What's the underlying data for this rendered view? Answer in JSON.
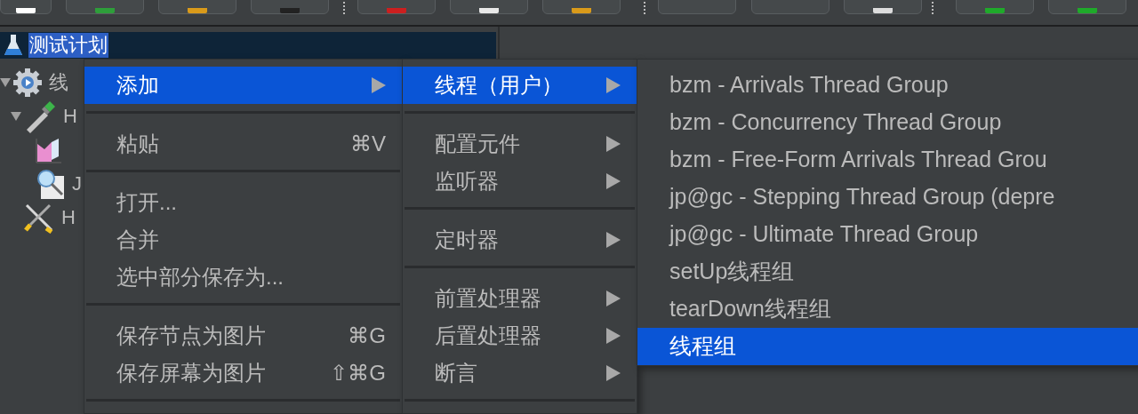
{
  "tree": {
    "items": [
      {
        "label": "测试计划",
        "kind": "test-plan",
        "selected": true,
        "children": [
          {
            "label": "线",
            "kind": "thread-group",
            "selected": false,
            "expanded": true,
            "children": [
              {
                "label": "H",
                "kind": "sampler",
                "selected": false,
                "expanded": true,
                "children": [
                  {
                    "kind": "listener",
                    "selected": false
                  },
                  {
                    "label": "J",
                    "kind": "inspector",
                    "selected": false
                  }
                ]
              },
              {
                "label": "H",
                "kind": "config",
                "selected": false
              }
            ]
          }
        ]
      }
    ]
  },
  "menus": [
    {
      "items": [
        {
          "kind": "item",
          "label": "添加",
          "has_submenu": true,
          "selected": true
        },
        {
          "kind": "separator"
        },
        {
          "kind": "item",
          "label": "粘贴",
          "shortcut": "⌘V",
          "has_submenu": false,
          "selected": false
        },
        {
          "kind": "separator"
        },
        {
          "kind": "item",
          "label": "打开...",
          "has_submenu": false,
          "selected": false
        },
        {
          "kind": "item",
          "label": "合并",
          "has_submenu": false,
          "selected": false
        },
        {
          "kind": "item",
          "label": "选中部分保存为...",
          "has_submenu": false,
          "selected": false
        },
        {
          "kind": "separator"
        },
        {
          "kind": "item",
          "label": "保存节点为图片",
          "shortcut": "⌘G",
          "has_submenu": false,
          "selected": false
        },
        {
          "kind": "item",
          "label": "保存屏幕为图片",
          "shortcut": "⇧⌘G",
          "has_submenu": false,
          "selected": false
        },
        {
          "kind": "separator"
        }
      ]
    },
    {
      "items": [
        {
          "kind": "item",
          "label": "线程（用户）",
          "has_submenu": true,
          "selected": true
        },
        {
          "kind": "separator"
        },
        {
          "kind": "item",
          "label": "配置元件",
          "has_submenu": true,
          "selected": false
        },
        {
          "kind": "item",
          "label": "监听器",
          "has_submenu": true,
          "selected": false
        },
        {
          "kind": "separator"
        },
        {
          "kind": "item",
          "label": "定时器",
          "has_submenu": true,
          "selected": false
        },
        {
          "kind": "separator"
        },
        {
          "kind": "item",
          "label": "前置处理器",
          "has_submenu": true,
          "selected": false
        },
        {
          "kind": "item",
          "label": "后置处理器",
          "has_submenu": true,
          "selected": false
        },
        {
          "kind": "item",
          "label": "断言",
          "has_submenu": true,
          "selected": false
        },
        {
          "kind": "separator"
        }
      ]
    },
    {
      "items": [
        {
          "kind": "item",
          "label": "bzm - Arrivals Thread Group",
          "has_submenu": false,
          "selected": false
        },
        {
          "kind": "item",
          "label": "bzm - Concurrency Thread Group",
          "has_submenu": false,
          "selected": false
        },
        {
          "kind": "item",
          "label": "bzm - Free-Form Arrivals Thread Grou",
          "has_submenu": false,
          "selected": false
        },
        {
          "kind": "item",
          "label": "jp@gc - Stepping Thread Group (depre",
          "has_submenu": false,
          "selected": false
        },
        {
          "kind": "item",
          "label": "jp@gc - Ultimate Thread Group",
          "has_submenu": false,
          "selected": false
        },
        {
          "kind": "item",
          "label": "setUp线程组",
          "has_submenu": false,
          "selected": false
        },
        {
          "kind": "item",
          "label": "tearDown线程组",
          "has_submenu": false,
          "selected": false
        },
        {
          "kind": "item",
          "label": "线程组",
          "has_submenu": false,
          "selected": true
        }
      ]
    }
  ]
}
